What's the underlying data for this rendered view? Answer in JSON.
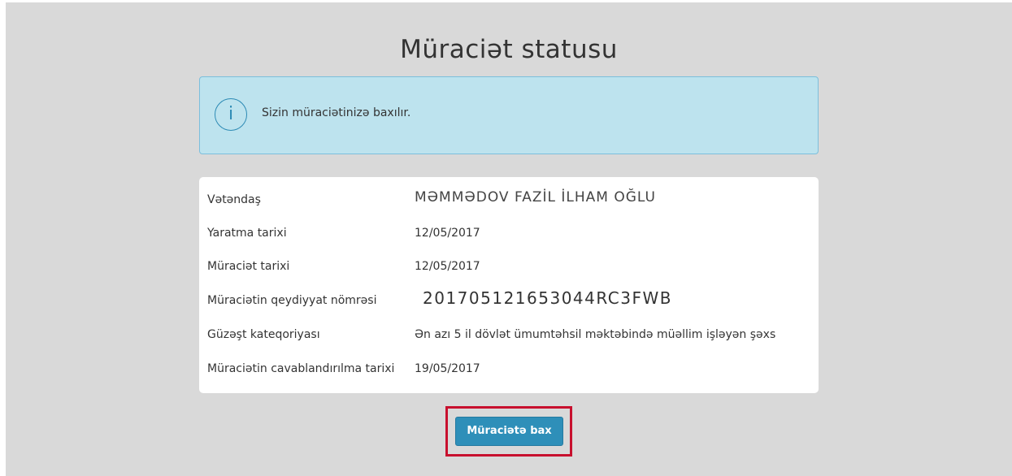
{
  "page": {
    "title": "Müraciət statusu"
  },
  "alert": {
    "icon": "info-icon",
    "icon_glyph": "i",
    "message": "Sizin müraciətinizə baxılır."
  },
  "details": [
    {
      "label": "Vətəndaş",
      "value": "MƏMMƏDOV FAZİL İLHAM OĞLU"
    },
    {
      "label": "Yaratma tarixi",
      "value": "12/05/2017"
    },
    {
      "label": "Müraciət tarixi",
      "value": "12/05/2017"
    },
    {
      "label": "Müraciətin qeydiyyat nömrəsi",
      "value": "201705121653044RC3FWB"
    },
    {
      "label": "Güzəşt kateqoriyası",
      "value": "Ən azı 5 il dövlət ümumtəhsil məktəbində müəllim işləyən şəxs"
    },
    {
      "label": "Müraciətin cavablandırılma tarixi",
      "value": "19/05/2017"
    }
  ],
  "actions": {
    "view_button_label": "Müraciətə bax"
  },
  "colors": {
    "accent": "#2e8fb9",
    "alert_bg": "#bde3ee",
    "highlight": "#c8102e",
    "page_bg": "#d9d9d9"
  }
}
